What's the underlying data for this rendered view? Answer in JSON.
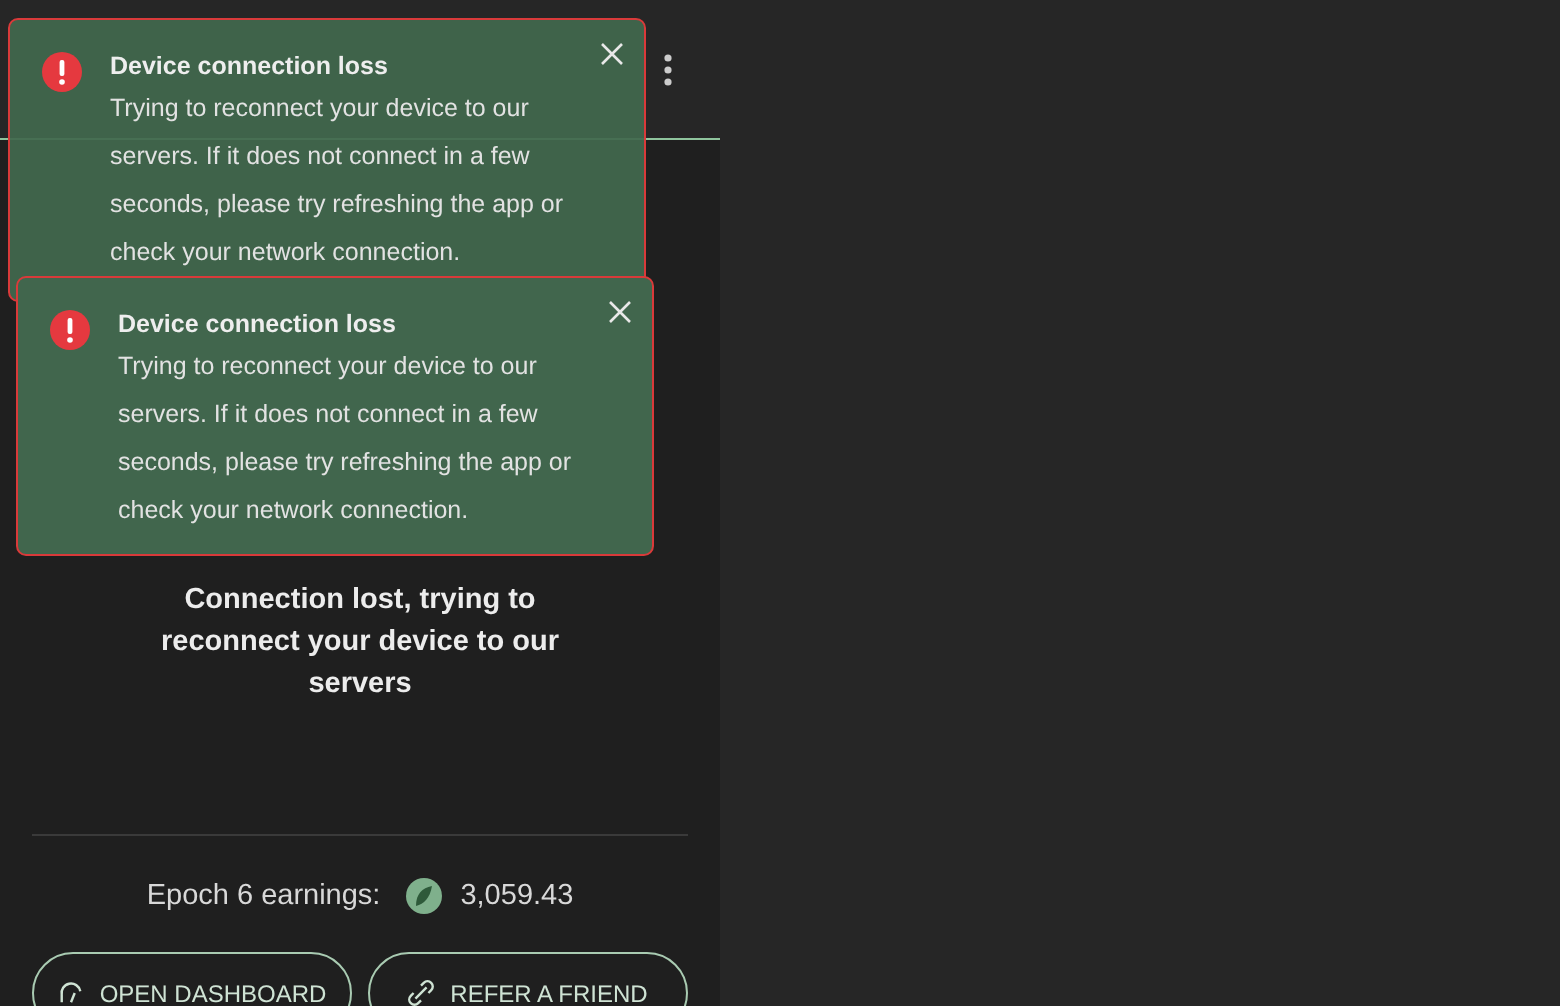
{
  "toasts": [
    {
      "title": "Device connection loss",
      "message": "Trying to reconnect your device to our servers. If it does not connect in a few seconds, please try refreshing the app or check your network connection.",
      "kind": "error"
    },
    {
      "title": "Device connection loss",
      "message": "Trying to reconnect your device to our servers. If it does not connect in a few seconds, please try refreshing the app or check your network connection.",
      "kind": "error"
    }
  ],
  "status_message": "Connection lost, trying to reconnect your device to our servers",
  "earnings": {
    "label": "Epoch 6 earnings:",
    "value": "3,059.43"
  },
  "buttons": [
    {
      "label": "OPEN DASHBOARD",
      "kind": "dashboard"
    },
    {
      "label": "REFER A FRIEND",
      "kind": "refer"
    }
  ]
}
